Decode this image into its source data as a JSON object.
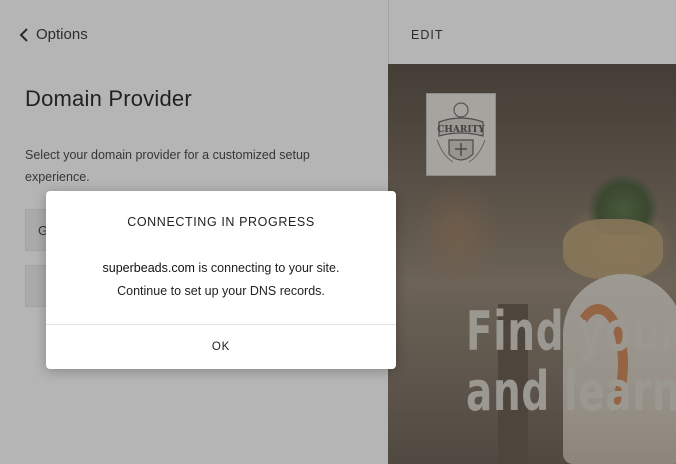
{
  "left_panel": {
    "back_label": "Options",
    "title": "Domain Provider",
    "description": "Select your domain provider for a customized setup experience.",
    "provider_rows": [
      {
        "label": "G"
      },
      {
        "label": ""
      }
    ]
  },
  "right_panel": {
    "edit_label": "EDIT",
    "logo_text": "CHARITY",
    "hero_line1": "Find your",
    "hero_line2": "and learn"
  },
  "modal": {
    "title": "CONNECTING IN PROGRESS",
    "domain": "superbeads.com",
    "line1_suffix": " is connecting to your site.",
    "line2": "Continue to set up your DNS records.",
    "ok_label": "OK"
  },
  "colors": {
    "overlay": "#3c3c3c",
    "modal_bg": "#ffffff",
    "accent_orange": "#c86a2e"
  }
}
